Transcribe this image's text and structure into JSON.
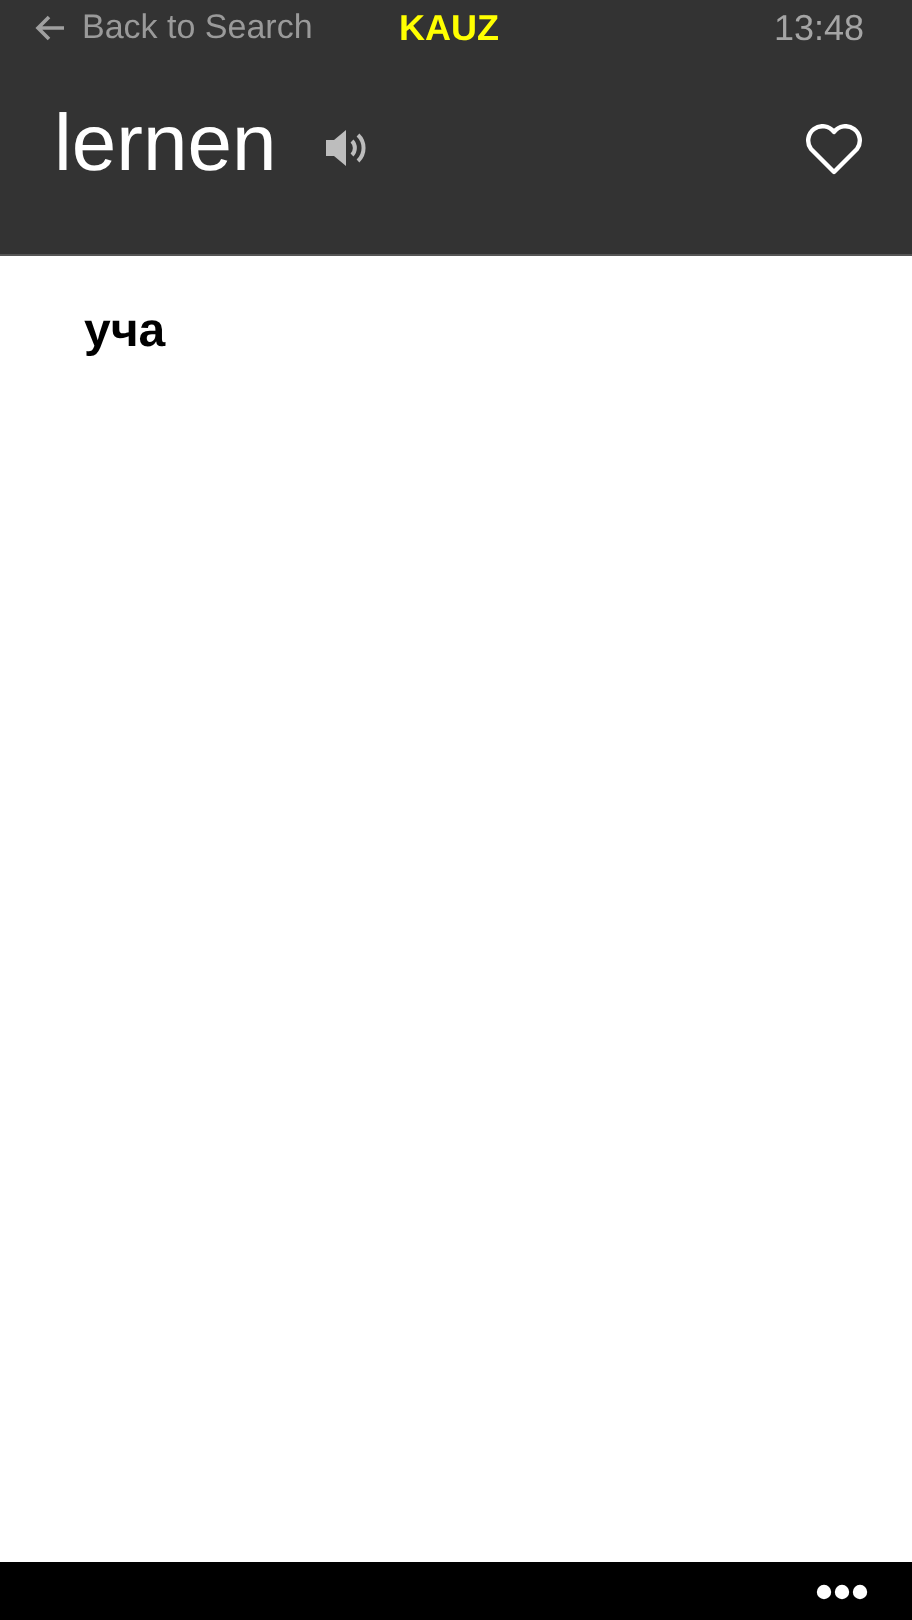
{
  "status_bar": {
    "back_label": "Back to Search",
    "app_name": "KAUZ",
    "time": "13:48"
  },
  "header": {
    "word": "lernen"
  },
  "translations": [
    "уча"
  ]
}
